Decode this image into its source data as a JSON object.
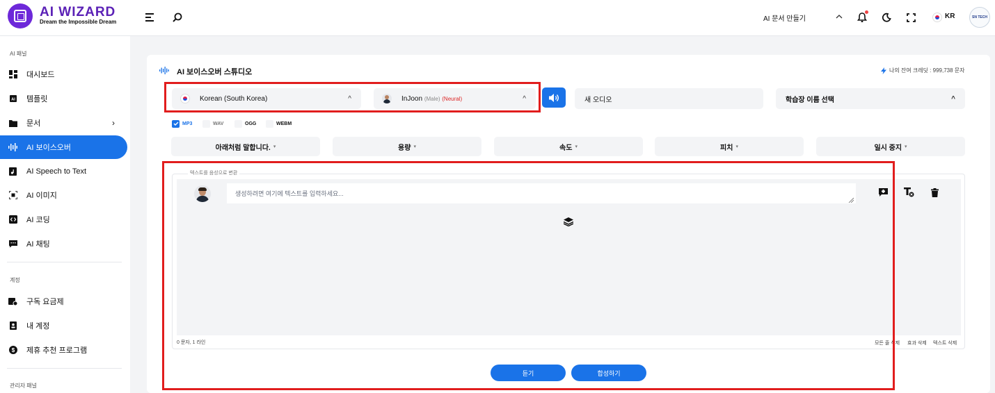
{
  "colors": {
    "brand": "#5b21b6",
    "accent": "#1a73e8",
    "highlight": "#e11d1d"
  },
  "header": {
    "brand": "AI WIZARD",
    "tagline": "Dream the Impossible Dream",
    "create_doc": "AI 문서 만들기",
    "language": "KR",
    "avatar_text": "SN TECH",
    "icons": [
      "menu-icon",
      "search-icon",
      "chevron-up-icon",
      "bell-icon",
      "moon-icon",
      "fullscreen-icon",
      "flag-icon",
      "avatar"
    ]
  },
  "sidebar": {
    "section_ai": "AI 패널",
    "section_account": "계정",
    "section_admin": "관리자 패널",
    "items": [
      {
        "label": "대시보드",
        "icon": "dashboard-icon"
      },
      {
        "label": "템플릿",
        "icon": "ai-template-icon"
      },
      {
        "label": "문서",
        "icon": "folder-icon"
      },
      {
        "label": "AI 보이스오버",
        "icon": "waveform-icon"
      },
      {
        "label": "AI Speech to Text",
        "icon": "audio-file-icon"
      },
      {
        "label": "AI 이미지",
        "icon": "image-scan-icon"
      },
      {
        "label": "AI 코딩",
        "icon": "code-icon"
      },
      {
        "label": "AI 채팅",
        "icon": "chat-icon"
      }
    ],
    "account_items": [
      {
        "label": "구독 요금제",
        "icon": "subscription-icon"
      },
      {
        "label": "내 계정",
        "icon": "user-card-icon"
      },
      {
        "label": "제휴 추천 프로그램",
        "icon": "dollar-icon"
      }
    ]
  },
  "studio": {
    "title": "AI 보이스오버 스튜디오",
    "credits": "나의 잔여 크레딧 : 999,738 문자",
    "language": "Korean (South Korea)",
    "voice_name": "InJoon",
    "voice_gender": "(Male)",
    "voice_type": "(Neural)",
    "audio_title": "새 오디오",
    "project_select": "학습장 이름 선택",
    "formats": [
      {
        "label": "MP3",
        "checked": true
      },
      {
        "label": "WAV",
        "checked": false
      },
      {
        "label": "OGG",
        "checked": false
      },
      {
        "label": "WEBM",
        "checked": false
      }
    ],
    "controls": [
      "아래처럼 말합니다.",
      "용량",
      "속도",
      "피치",
      "일시 중지"
    ],
    "tts_legend": "텍스트를 음성으로 변환",
    "textarea_placeholder": "생성하려면 여기에 텍스트를 입력하세요...",
    "counter": "0 문자, 1 라인",
    "links": [
      "모든 줄 삭제",
      "효과 삭제",
      "텍스트 삭제"
    ],
    "listen_button": "듣기",
    "synthesize_button": "합성하기"
  }
}
